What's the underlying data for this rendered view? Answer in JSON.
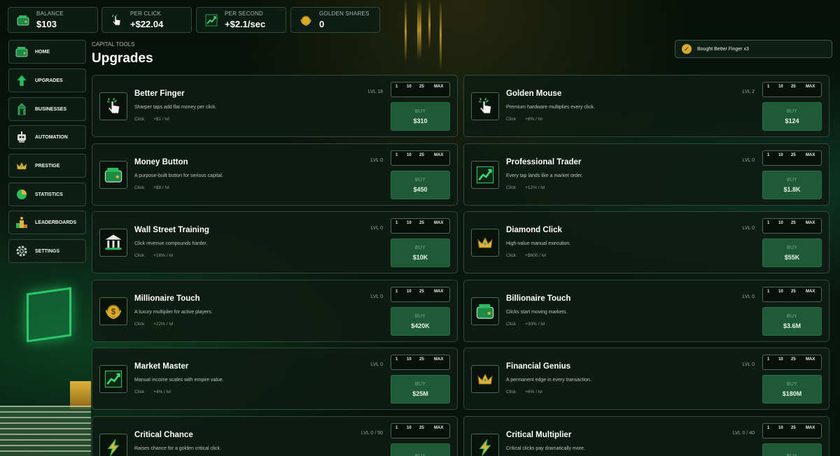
{
  "stats": [
    {
      "label": "BALANCE",
      "value": "$103",
      "icon": "wallet-icon"
    },
    {
      "label": "PER CLICK",
      "value": "+$22.04",
      "icon": "pointer-icon"
    },
    {
      "label": "PER SECOND",
      "value": "+$2.1/sec",
      "icon": "chart-icon"
    },
    {
      "label": "GOLDEN SHARES",
      "value": "0",
      "icon": "laurel-coin-icon"
    }
  ],
  "nav": [
    {
      "label": "HOME",
      "icon": "wallet-icon"
    },
    {
      "label": "UPGRADES",
      "icon": "arrow-up-icon"
    },
    {
      "label": "BUSINESSES",
      "icon": "building-icon"
    },
    {
      "label": "AUTOMATION",
      "icon": "robot-icon"
    },
    {
      "label": "PRESTIGE",
      "icon": "crown-icon"
    },
    {
      "label": "STATISTICS",
      "icon": "pie-chart-icon"
    },
    {
      "label": "LEADERBOARDS",
      "icon": "podium-icon"
    },
    {
      "label": "SETTINGS",
      "icon": "gear-icon"
    }
  ],
  "page": {
    "breadcrumb": "CAPITAL TOOLS",
    "title": "Upgrades"
  },
  "toast": {
    "text": "Bought Better Finger x3"
  },
  "qty_options": [
    "1",
    "10",
    "25",
    "MAX"
  ],
  "buy_label": "BUY",
  "upgrades": [
    {
      "name": "Better Finger",
      "desc": "Sharper taps add flat money per click.",
      "type": "Click",
      "effect": "+$1 / lvl",
      "level": "LVL 18",
      "price": "$310",
      "icon": "pointer-icon"
    },
    {
      "name": "Golden Mouse",
      "desc": "Premium hardware multiplies every click.",
      "type": "Click",
      "effect": "+8% / lvl",
      "level": "LVL 2",
      "price": "$124",
      "icon": "pointer-icon"
    },
    {
      "name": "Money Button",
      "desc": "A purpose-built button for serious capital.",
      "type": "Click",
      "effect": "+$8 / lvl",
      "level": "LVL 0",
      "price": "$450",
      "icon": "wallet-icon"
    },
    {
      "name": "Professional Trader",
      "desc": "Every tap lands like a market order.",
      "type": "Click",
      "effect": "+12% / lvl",
      "level": "LVL 0",
      "price": "$1.8K",
      "icon": "chart-icon"
    },
    {
      "name": "Wall Street Training",
      "desc": "Click revenue compounds harder.",
      "type": "Click",
      "effect": "+16% / lvl",
      "level": "LVL 0",
      "price": "$10K",
      "icon": "bank-icon"
    },
    {
      "name": "Diamond Click",
      "desc": "High-value manual execution.",
      "type": "Click",
      "effect": "+$600 / lvl",
      "level": "LVL 0",
      "price": "$55K",
      "icon": "crown-icon"
    },
    {
      "name": "Millionaire Touch",
      "desc": "A luxury multiplier for active players.",
      "type": "Click",
      "effect": "+22% / lvl",
      "level": "LVL 0",
      "price": "$420K",
      "icon": "laurel-coin-icon"
    },
    {
      "name": "Billionaire Touch",
      "desc": "Clicks start moving markets.",
      "type": "Click",
      "effect": "+30% / lvl",
      "level": "LVL 0",
      "price": "$3.6M",
      "icon": "wallet-icon"
    },
    {
      "name": "Market Master",
      "desc": "Manual income scales with empire value.",
      "type": "Click",
      "effect": "+4% / lvl",
      "level": "LVL 0",
      "price": "$25M",
      "icon": "chart-icon"
    },
    {
      "name": "Financial Genius",
      "desc": "A permanent edge in every transaction.",
      "type": "Click",
      "effect": "+6% / lvl",
      "level": "LVL 0",
      "price": "$180M",
      "icon": "crown-icon"
    },
    {
      "name": "Critical Chance",
      "desc": "Raises chance for a golden critical click.",
      "type": "",
      "effect": "",
      "level": "LVL 0 / 50",
      "price": "",
      "icon": "lightning-icon"
    },
    {
      "name": "Critical Multiplier",
      "desc": "Critical clicks pay dramatically more.",
      "type": "",
      "effect": "",
      "level": "LVL 0 / 40",
      "price": "",
      "icon": "lightning-icon"
    }
  ]
}
